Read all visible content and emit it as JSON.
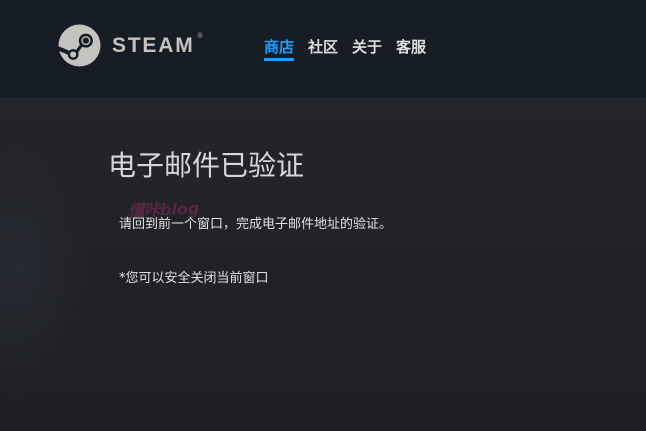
{
  "header": {
    "logo_text": "STEAM",
    "logo_reg": "®",
    "logo_icon": "steam-logo-icon",
    "nav": [
      {
        "label": "商店",
        "active": true
      },
      {
        "label": "社区",
        "active": false
      },
      {
        "label": "关于",
        "active": false
      },
      {
        "label": "客服",
        "active": false
      }
    ]
  },
  "main": {
    "title": "电子邮件已验证",
    "message": "请回到前一个窗口，完成电子邮件地址的验证。",
    "note": "*您可以安全关闭当前窗口",
    "watermark": "懂咔blog"
  },
  "colors": {
    "header_bg": "#171d25",
    "page_bg": "#1f2126",
    "accent": "#1a9fff",
    "text": "#dfe1e2"
  }
}
